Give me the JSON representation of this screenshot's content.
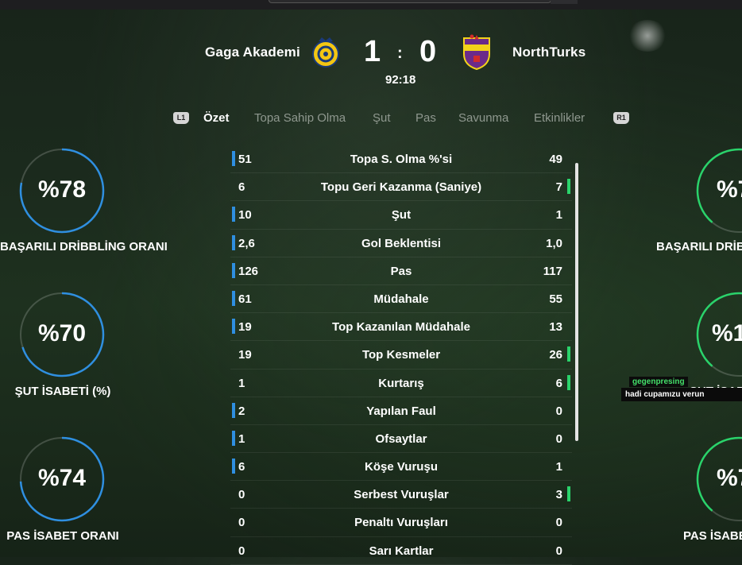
{
  "match": {
    "home_team": "Gaga Akademi",
    "away_team": "NorthTurks",
    "home_score": "1",
    "away_score": "0",
    "separator": ":",
    "clock": "92:18"
  },
  "tabs": {
    "left_shoulder": "L1",
    "right_shoulder": "R1",
    "items": [
      "Özet",
      "Topa Sahip Olma",
      "Şut",
      "Pas",
      "Savunma",
      "Etkinlikler"
    ],
    "active": "Özet"
  },
  "left_gauges": [
    {
      "value": "%78",
      "label": "BAŞARILI DRİBBLİNG ORANI",
      "percent": 78
    },
    {
      "value": "%70",
      "label": "ŞUT İSABETİ (%)",
      "percent": 70
    },
    {
      "value": "%74",
      "label": "PAS İSABET ORANI",
      "percent": 74
    }
  ],
  "right_gauges": [
    {
      "value": "%7",
      "label": "BAŞARILI DRİB"
    },
    {
      "value": "%1(",
      "label": "ŞUT İSABE"
    },
    {
      "value": "%7",
      "label": "PAS İSABE"
    }
  ],
  "stats": [
    {
      "name": "Topa S. Olma %'si",
      "home": "51",
      "away": "49",
      "leader": "home"
    },
    {
      "name": "Topu Geri Kazanma (Saniye)",
      "home": "6",
      "away": "7",
      "leader": "away"
    },
    {
      "name": "Şut",
      "home": "10",
      "away": "1",
      "leader": "home"
    },
    {
      "name": "Gol Beklentisi",
      "home": "2,6",
      "away": "1,0",
      "leader": "home"
    },
    {
      "name": "Pas",
      "home": "126",
      "away": "117",
      "leader": "home"
    },
    {
      "name": "Müdahale",
      "home": "61",
      "away": "55",
      "leader": "home"
    },
    {
      "name": "Top Kazanılan Müdahale",
      "home": "19",
      "away": "13",
      "leader": "home"
    },
    {
      "name": "Top Kesmeler",
      "home": "19",
      "away": "26",
      "leader": "away"
    },
    {
      "name": "Kurtarış",
      "home": "1",
      "away": "6",
      "leader": "away"
    },
    {
      "name": "Yapılan Faul",
      "home": "2",
      "away": "0",
      "leader": "home"
    },
    {
      "name": "Ofsaytlar",
      "home": "1",
      "away": "0",
      "leader": "home"
    },
    {
      "name": "Köşe Vuruşu",
      "home": "6",
      "away": "1",
      "leader": "home"
    },
    {
      "name": "Serbest Vuruşlar",
      "home": "0",
      "away": "3",
      "leader": "away"
    },
    {
      "name": "Penaltı Vuruşları",
      "home": "0",
      "away": "0",
      "leader": "none"
    },
    {
      "name": "Sarı Kartlar",
      "home": "0",
      "away": "0",
      "leader": "none"
    }
  ],
  "chat": {
    "username": "gegenpresing",
    "message": "hadi cupamızu verun"
  },
  "colors": {
    "home_accent": "#2f8fe0",
    "away_accent": "#2ad36b"
  }
}
